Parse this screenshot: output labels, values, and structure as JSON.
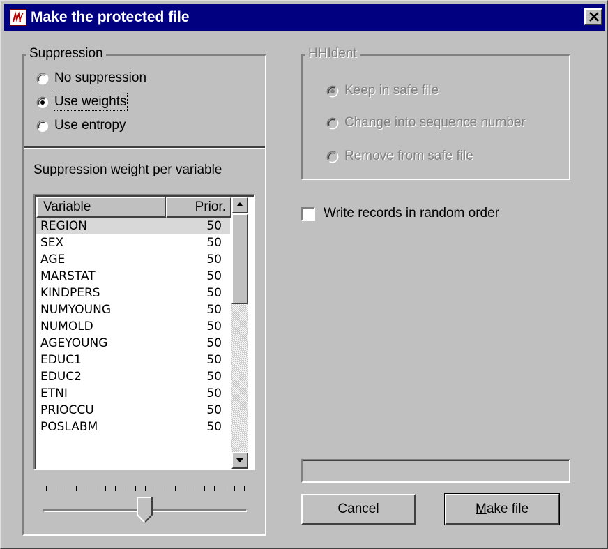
{
  "window": {
    "title": "Make the protected file",
    "icon": "mu-argus-app-icon",
    "close_icon": "close-x-icon"
  },
  "suppression": {
    "legend": "Suppression",
    "options": [
      {
        "label": "No suppression",
        "checked": false
      },
      {
        "label": "Use weights",
        "checked": true
      },
      {
        "label": "Use entropy",
        "checked": false
      }
    ],
    "weight_label": "Suppression weight per variable",
    "table": {
      "columns": [
        "Variable",
        "Prior."
      ],
      "rows": [
        {
          "variable": "REGION",
          "priority": "50",
          "selected": true
        },
        {
          "variable": "SEX",
          "priority": "50"
        },
        {
          "variable": "AGE",
          "priority": "50"
        },
        {
          "variable": "MARSTAT",
          "priority": "50"
        },
        {
          "variable": "KINDPERS",
          "priority": "50"
        },
        {
          "variable": "NUMYOUNG",
          "priority": "50"
        },
        {
          "variable": "NUMOLD",
          "priority": "50"
        },
        {
          "variable": "AGEYOUNG",
          "priority": "50"
        },
        {
          "variable": "EDUC1",
          "priority": "50"
        },
        {
          "variable": "EDUC2",
          "priority": "50"
        },
        {
          "variable": "ETNI",
          "priority": "50"
        },
        {
          "variable": "PRIOCCU",
          "priority": "50"
        },
        {
          "variable": "POSLABM",
          "priority": "50"
        }
      ]
    },
    "slider": {
      "value_fraction": 0.5,
      "ticks": 21
    }
  },
  "hhident": {
    "legend": "HHIdent",
    "enabled": false,
    "options": [
      {
        "label": "Keep in safe file",
        "checked": true
      },
      {
        "label": "Change into sequence number",
        "checked": false
      },
      {
        "label": "Remove from safe file",
        "checked": false
      }
    ]
  },
  "random_order": {
    "label": "Write records in random order",
    "checked": false
  },
  "progress": {
    "value_fraction": 0
  },
  "buttons": {
    "cancel": "Cancel",
    "make_file_mnemonic": "M",
    "make_file_rest": "ake file"
  },
  "colors": {
    "face": "#c0c0c0",
    "titlebar": "#000080",
    "disabled_text": "#808080"
  }
}
